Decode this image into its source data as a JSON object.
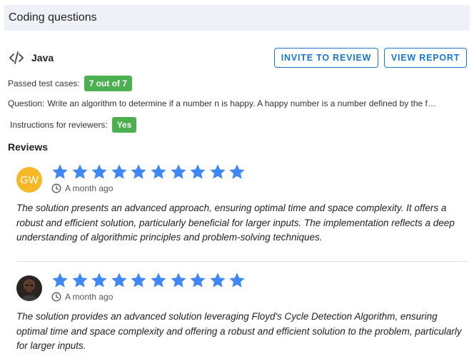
{
  "section": {
    "title": "Coding questions"
  },
  "question": {
    "language": "Java",
    "language_icon": "code-icon",
    "passed_label": "Passed test cases:",
    "passed_value": "7 out of 7",
    "question_label": "Question:",
    "question_text": "Write an algorithm to determine if a number n is happy. A happy number is a number defined by the f…",
    "instructions_label": "Instructions for reviewers:",
    "instructions_value": "Yes"
  },
  "actions": {
    "invite_label": "INVITE TO REVIEW",
    "report_label": "VIEW REPORT"
  },
  "colors": {
    "accent": "#1976d2",
    "star": "#3f87f5",
    "badge_green": "#4caf50",
    "avatar_yellow": "#f6b826"
  },
  "reviews": {
    "title": "Reviews",
    "items": [
      {
        "avatar_initials": "GW",
        "rating": 10,
        "max_rating": 10,
        "time": "A month ago",
        "text": "The solution presents an advanced approach, ensuring optimal time and space complexity. It offers a robust and efficient solution, particularly beneficial for larger inputs. The implementation reflects a deep understanding of algorithmic principles and problem-solving techniques."
      },
      {
        "avatar_initials": "",
        "rating": 10,
        "max_rating": 10,
        "time": "A month ago",
        "text": "The solution provides an advanced solution leveraging Floyd's Cycle Detection Algorithm, ensuring optimal time and space complexity and offering a robust and efficient solution to the problem, particularly for larger inputs."
      }
    ]
  }
}
